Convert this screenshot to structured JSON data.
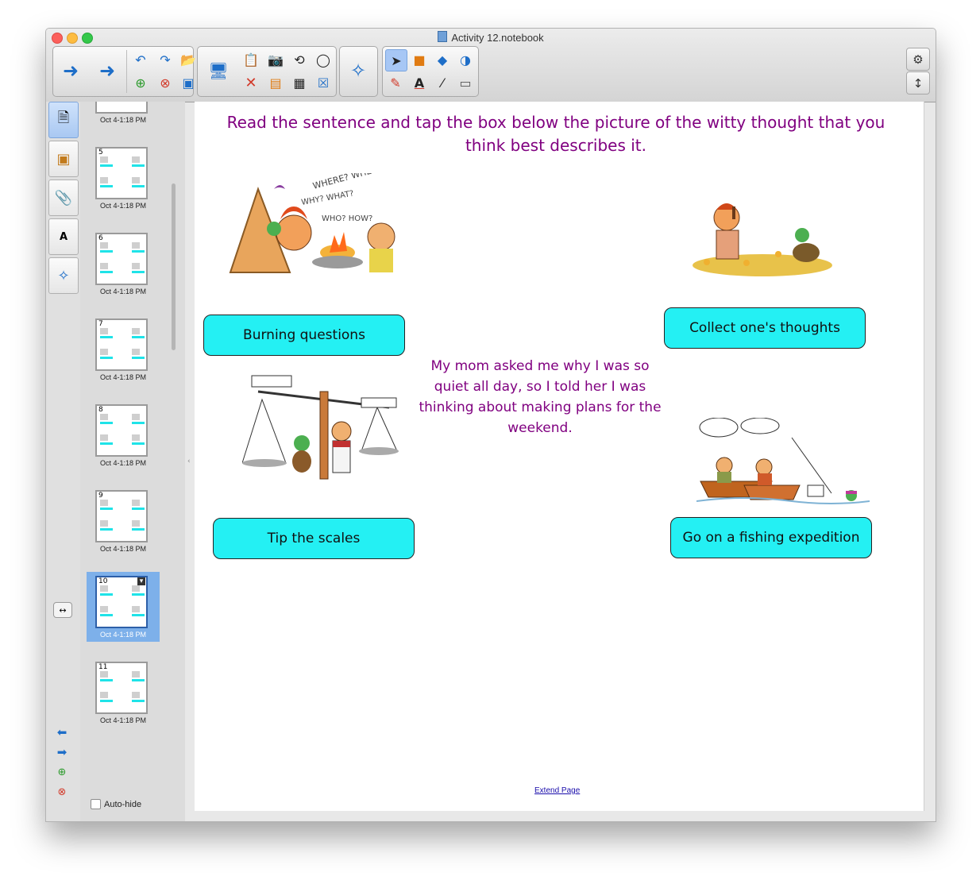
{
  "window": {
    "title": "Activity 12.notebook"
  },
  "toolbar": {
    "back_icon": "left-arrow-icon",
    "forward_icon": "right-arrow-icon",
    "tools": [
      "undo-icon",
      "redo-icon",
      "open-icon",
      "add-page-icon",
      "delete-page-icon",
      "save-icon",
      "screen-shade-icon",
      "paste-icon",
      "screen-capture-icon",
      "rotate-icon",
      "ink-recognition-icon",
      "delete-icon",
      "table-icon",
      "clear-icon",
      "addon-icon",
      "select-icon",
      "shapes-icon",
      "eraser-icon",
      "fill-icon",
      "pens-icon",
      "text-icon",
      "lines-icon",
      "magic-eraser-icon"
    ]
  },
  "page_sorter": {
    "thumbnails": [
      {
        "number": "",
        "caption": "Oct 4-1:18 PM",
        "selected": false
      },
      {
        "number": "5",
        "caption": "Oct 4-1:18 PM",
        "selected": false
      },
      {
        "number": "6",
        "caption": "Oct 4-1:18 PM",
        "selected": false
      },
      {
        "number": "7",
        "caption": "Oct 4-1:18 PM",
        "selected": false
      },
      {
        "number": "8",
        "caption": "Oct 4-1:18 PM",
        "selected": false
      },
      {
        "number": "9",
        "caption": "Oct 4-1:18 PM",
        "selected": false
      },
      {
        "number": "10",
        "caption": "Oct 4-1:18 PM",
        "selected": true
      },
      {
        "number": "11",
        "caption": "Oct 4-1:18 PM",
        "selected": false
      }
    ],
    "autohide_label": "Auto-hide",
    "autohide_checked": false
  },
  "page": {
    "instruction": "Read the sentence and tap the box below the picture of the witty thought that you think best describes it.",
    "sentence": "My mom asked me why I was so quiet all day, so I told her I was thinking about making plans for the weekend.",
    "answers": {
      "burning": "Burning questions",
      "collect": "Collect one's thoughts",
      "tip": "Tip the scales",
      "fishing": "Go on a fishing expedition"
    },
    "extend_link": "Extend Page"
  },
  "colors": {
    "instruction_text": "#800080",
    "answer_box": "#24f0f3",
    "selected_thumb": "#7db0ea"
  }
}
